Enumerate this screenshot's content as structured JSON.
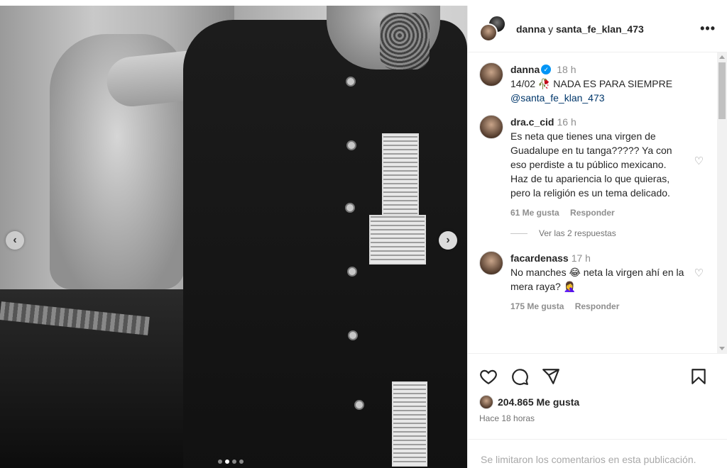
{
  "header": {
    "user1": "danna",
    "conjunction": "y",
    "user2": "santa_fe_klan_473",
    "more": "•••"
  },
  "caption": {
    "user": "danna",
    "time": "18 h",
    "text": "14/02 🥀 NADA ES PARA SIEMPRE",
    "mention": "@santa_fe_klan_473"
  },
  "comments": [
    {
      "user": "dra.c_cid",
      "time": "16 h",
      "text": "Es neta que tienes una virgen de Guadalupe en tu tanga????? Ya con eso perdiste a tu público mexicano. Haz de tu apariencia lo que quieras, pero la religión es un tema delicado.",
      "likes": "61 Me gusta",
      "reply": "Responder",
      "view_replies": "Ver las 2 respuestas"
    },
    {
      "user": "facardenass",
      "time": "17 h",
      "text": "No manches 😂 neta la virgen ahí en la mera raya? 🤦‍♀️",
      "likes": "175 Me gusta",
      "reply": "Responder"
    }
  ],
  "stats": {
    "likes": "204.865 Me gusta",
    "posted": "Hace 18 horas"
  },
  "footer": {
    "comments_limited": "Se limitaron los comentarios en esta publicación."
  },
  "carousel": {
    "prev": "‹",
    "next": "›",
    "current_index": 2,
    "total": 4
  },
  "icons": [
    "heart-icon",
    "comment-icon",
    "share-icon",
    "bookmark-icon",
    "more-icon",
    "verified-badge-icon"
  ],
  "colors": {
    "verified": "#0095f6",
    "mention": "#00376b",
    "muted": "#8e8e8e"
  }
}
